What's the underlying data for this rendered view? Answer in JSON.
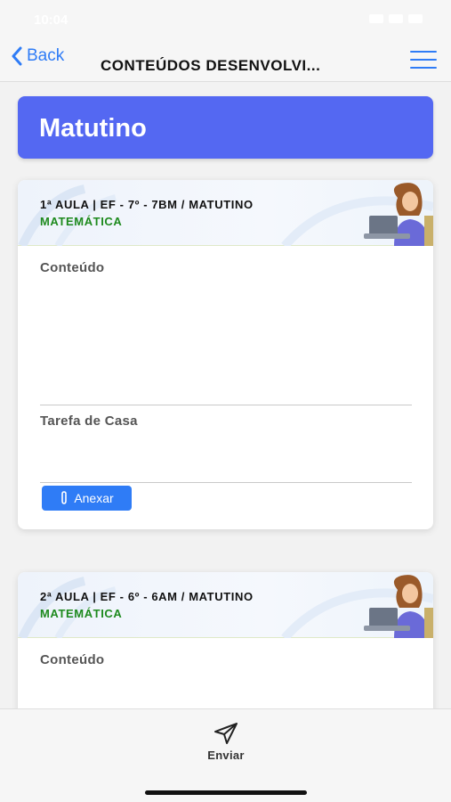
{
  "status_bar": {
    "time": "10:04"
  },
  "nav": {
    "back_label": "Back",
    "title": "CONTEÚDOS DESENVOLVI..."
  },
  "banner": {
    "shift": "Matutino"
  },
  "lessons": [
    {
      "title": "1ª AULA | EF - 7º - 7BM / MATUTINO",
      "subject": "MATEMÁTICA",
      "content_label": "Conteúdo",
      "homework_label": "Tarefa de Casa",
      "attach_label": "Anexar"
    },
    {
      "title": "2ª AULA | EF - 6º - 6AM / MATUTINO",
      "subject": "MATEMÁTICA",
      "content_label": "Conteúdo"
    }
  ],
  "bottom": {
    "send_label": "Enviar"
  },
  "colors": {
    "accent": "#2f7cf6",
    "banner": "#5468f2",
    "subject": "#1e8a1e"
  },
  "icons": [
    "chevron-left-icon",
    "hamburger-menu-icon",
    "paperclip-icon",
    "send-icon"
  ]
}
